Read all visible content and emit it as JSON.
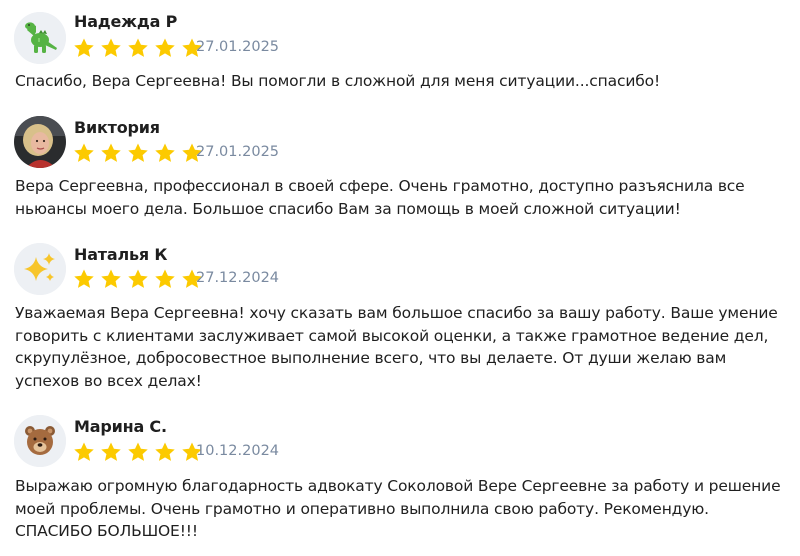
{
  "reviews": [
    {
      "name": "Надежда Р",
      "avatar_icon": "dinosaur-emoji-icon",
      "rating": 5,
      "date": "27.01.2025",
      "text": "Спасибо, Вера Сергеевна! Вы помогли в сложной для меня ситуации...спасибо!"
    },
    {
      "name": "Виктория",
      "avatar_icon": "user-photo",
      "rating": 5,
      "date": "27.01.2025",
      "text": "Вера Сергеевна, профессионал в своей сфере. Очень грамотно, доступно разъяснила все ньюансы моего дела. Большое спасибо Вам за помощь в моей сложной ситуации!"
    },
    {
      "name": "Наталья К",
      "avatar_icon": "sparkles-emoji-icon",
      "rating": 5,
      "date": "27.12.2024",
      "text": "Уважаемая Вера Сергеевна! хочу сказать вам большое спасибо за вашу работу. Ваше умение говорить с клиентами заслуживает самой высокой оценки, а также грамотное ведение дел, скрупулёзное, добросовестное выполнение всего, что вы делаете. От души желаю вам успехов во всех делах!"
    },
    {
      "name": "Марина С.",
      "avatar_icon": "bear-emoji-icon",
      "rating": 5,
      "date": "10.12.2024",
      "text": "Выражаю огромную благодарность адвокату Соколовой Вере Сергеевне за работу и решение моей проблемы. Очень грамотно и оперативно выполнила свою работу. Рекомендую. СПАСИБО БОЛЬШОЕ!!!"
    }
  ],
  "colors": {
    "star": "#fcca00",
    "date": "#7a8aa0",
    "avatar_bg": "#edf0f4",
    "text": "#1f1f1f"
  }
}
